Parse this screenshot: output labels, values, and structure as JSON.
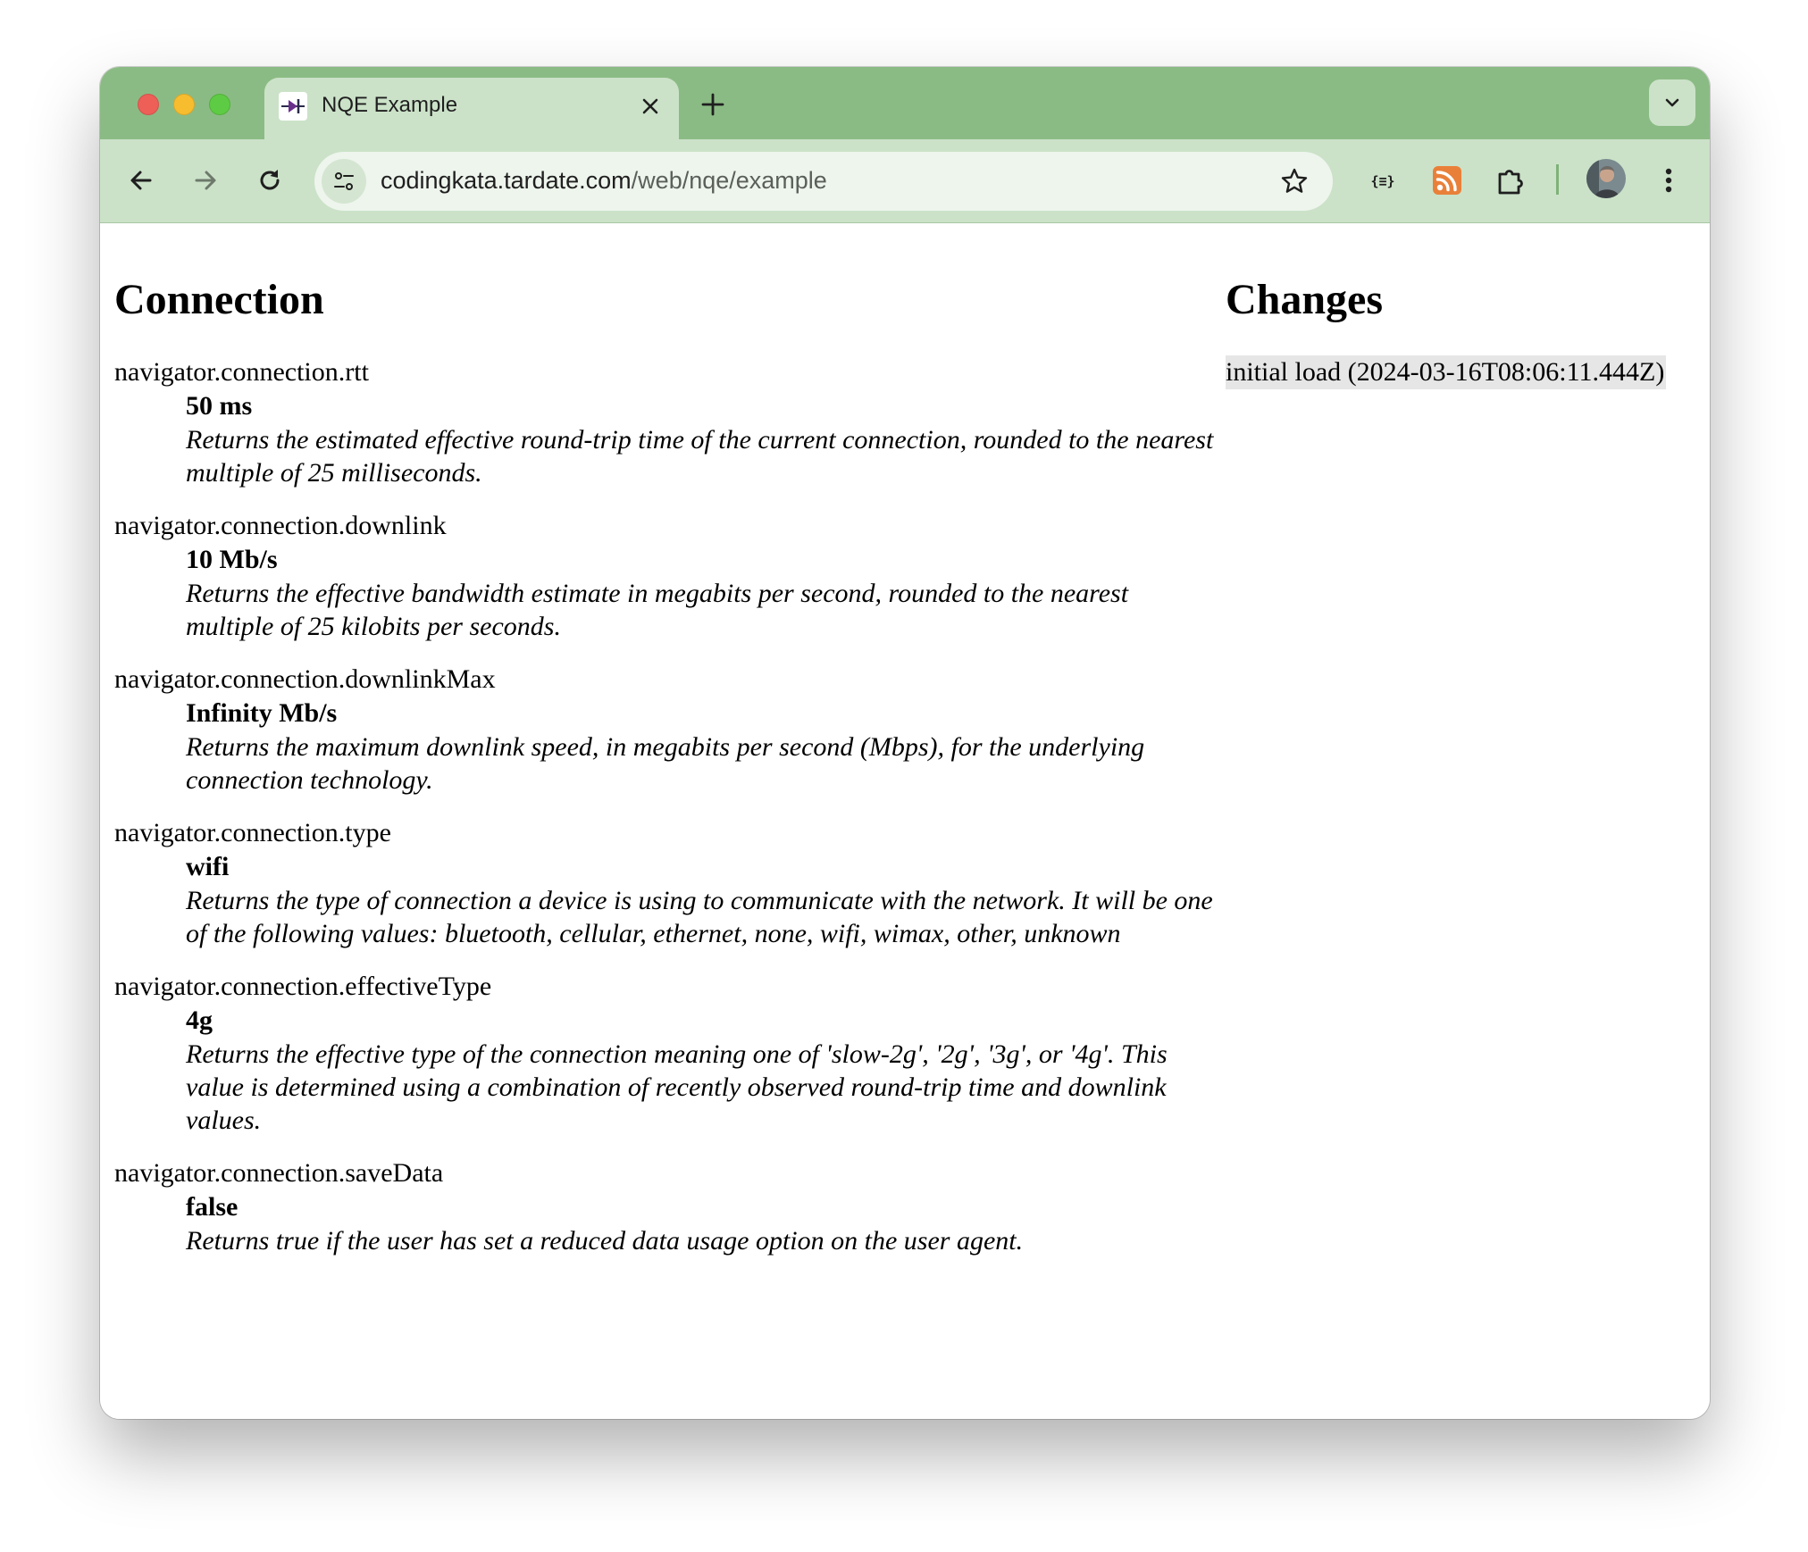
{
  "browser": {
    "tab_title": "NQE Example",
    "url_host": "codingkata.tardate.com",
    "url_path": "/web/nqe/example"
  },
  "connection": {
    "heading": "Connection",
    "entries": [
      {
        "property": "navigator.connection.rtt",
        "value": "50 ms",
        "description": "Returns the estimated effective round-trip time of the current connection, rounded to the nearest multiple of 25 milliseconds."
      },
      {
        "property": "navigator.connection.downlink",
        "value": "10 Mb/s",
        "description": "Returns the effective bandwidth estimate in megabits per second, rounded to the nearest multiple of 25 kilobits per seconds."
      },
      {
        "property": "navigator.connection.downlinkMax",
        "value": "Infinity Mb/s",
        "description": "Returns the maximum downlink speed, in megabits per second (Mbps), for the underlying connection technology."
      },
      {
        "property": "navigator.connection.type",
        "value": "wifi",
        "description": "Returns the type of connection a device is using to communicate with the network. It will be one of the following values: bluetooth, cellular, ethernet, none, wifi, wimax, other, unknown"
      },
      {
        "property": "navigator.connection.effectiveType",
        "value": "4g",
        "description": "Returns the effective type of the connection meaning one of 'slow-2g', '2g', '3g', or '4g'. This value is determined using a combination of recently observed round-trip time and downlink values."
      },
      {
        "property": "navigator.connection.saveData",
        "value": "false",
        "description": "Returns true if the user has set a reduced data usage option on the user agent."
      }
    ]
  },
  "changes": {
    "heading": "Changes",
    "items": [
      "initial load (2024-03-16T08:06:11.444Z)"
    ]
  },
  "icons": {
    "tab_favicon": "diode-icon",
    "tab_close": "close-icon",
    "new_tab": "plus-icon",
    "tab_dropdown": "chevron-down-icon",
    "back": "arrow-left-icon",
    "forward": "arrow-right-icon",
    "reload": "reload-icon",
    "site_info": "tune-icon",
    "bookmark": "star-icon",
    "json_extension": "json-braces-icon",
    "rss_extension": "rss-icon",
    "extensions": "puzzle-icon",
    "profile": "avatar",
    "menu": "kebab-menu-icon"
  },
  "colors": {
    "tabstrip": "#8bbb84",
    "toolbar": "#cbe2c8",
    "rss": "#e9803a"
  }
}
